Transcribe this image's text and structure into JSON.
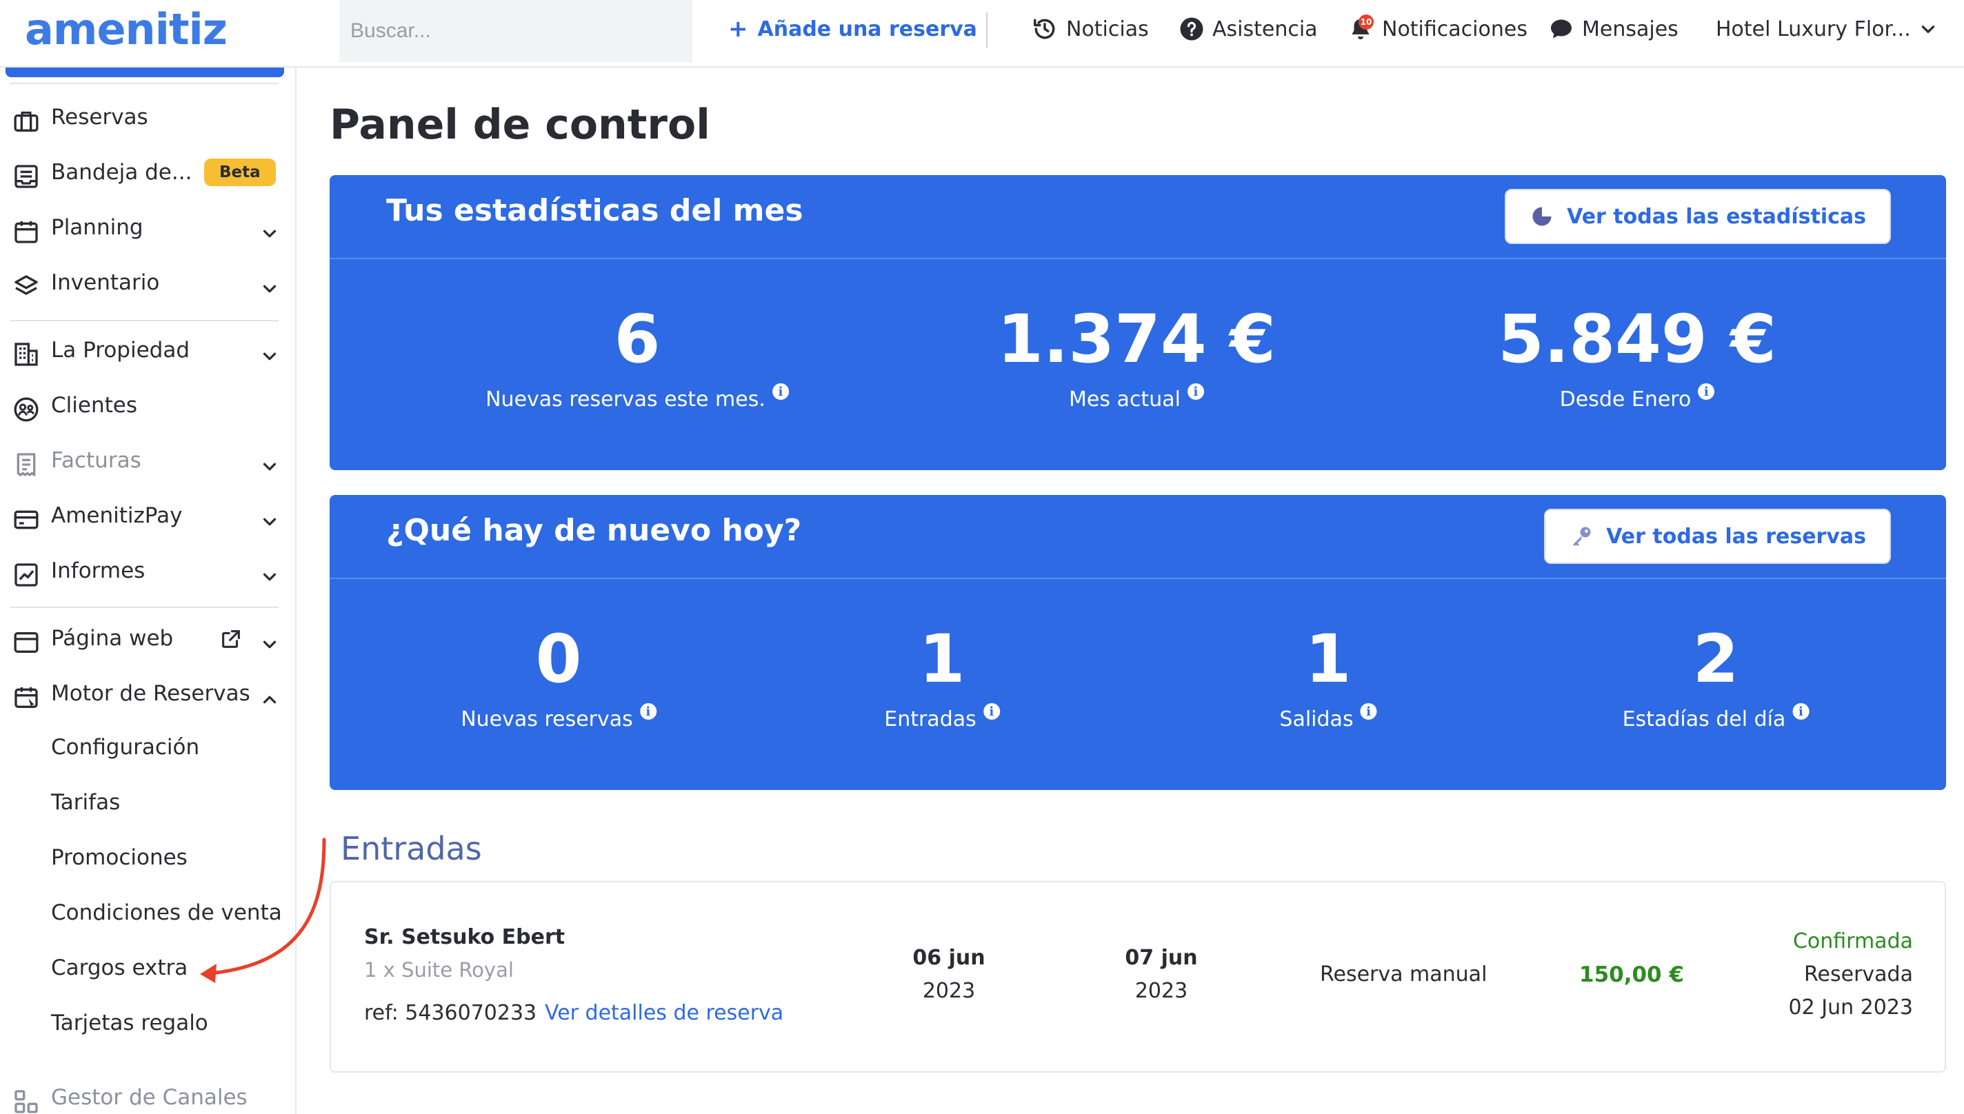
{
  "brand": {
    "logo_text": "amenitiz"
  },
  "header": {
    "search_placeholder": "Buscar...",
    "add_reservation": "Añade una reserva",
    "news": "Noticias",
    "help": "Asistencia",
    "notifications": "Notificaciones",
    "notifications_badge": "10",
    "messages": "Mensajes",
    "hotel_name": "Hotel Luxury Flor..."
  },
  "sidebar": {
    "items": [
      {
        "label": "Reservas",
        "icon": "briefcase-icon"
      },
      {
        "label": "Bandeja de...",
        "icon": "inbox-icon",
        "badge": "Beta"
      },
      {
        "label": "Planning",
        "icon": "calendar-icon"
      },
      {
        "label": "Inventario",
        "icon": "layers-icon"
      },
      {
        "label": "La Propiedad",
        "icon": "building-icon"
      },
      {
        "label": "Clientes",
        "icon": "clients-icon"
      },
      {
        "label": "Facturas",
        "icon": "invoice-icon"
      },
      {
        "label": "AmenitizPay",
        "icon": "card-icon"
      },
      {
        "label": "Informes",
        "icon": "chart-icon"
      },
      {
        "label": "Página web",
        "icon": "browser-icon"
      },
      {
        "label": "Motor de Reservas",
        "icon": "booking-engine-icon"
      },
      {
        "label": "Gestor de Canales",
        "icon": "channels-icon"
      }
    ],
    "booking_engine_sub": [
      "Configuración",
      "Tarifas",
      "Promociones",
      "Condiciones de venta",
      "Cargos extra",
      "Tarjetas regalo"
    ]
  },
  "main": {
    "title": "Panel de control",
    "month_stats": {
      "title": "Tus estadísticas del mes",
      "button": "Ver todas las estadísticas",
      "stats": [
        {
          "value": "6",
          "label": "Nuevas reservas este mes."
        },
        {
          "value": "1.374 €",
          "label": "Mes actual"
        },
        {
          "value": "5.849 €",
          "label": "Desde Enero"
        }
      ]
    },
    "today": {
      "title": "¿Qué hay de nuevo hoy?",
      "button": "Ver todas las reservas",
      "stats": [
        {
          "value": "0",
          "label": "Nuevas reservas"
        },
        {
          "value": "1",
          "label": "Entradas"
        },
        {
          "value": "1",
          "label": "Salidas"
        },
        {
          "value": "2",
          "label": "Estadías del día"
        }
      ]
    },
    "arrivals": {
      "title": "Entradas",
      "booking": {
        "guest": "Sr. Setsuko Ebert",
        "room": "1 x Suite Royal",
        "ref": "ref: 5436070233",
        "details_link": "Ver detalles de reserva",
        "checkin_day": "06 jun",
        "checkin_year": "2023",
        "checkout_day": "07 jun",
        "checkout_year": "2023",
        "source": "Reserva manual",
        "price": "150,00 €",
        "status": "Confirmada",
        "reserved_label": "Reservada",
        "reserved_date": "02 Jun 2023"
      }
    }
  },
  "colors": {
    "primary": "#2d6ae3",
    "confirmed": "#2e8a21",
    "annotation_arrow": "#e8402b"
  }
}
